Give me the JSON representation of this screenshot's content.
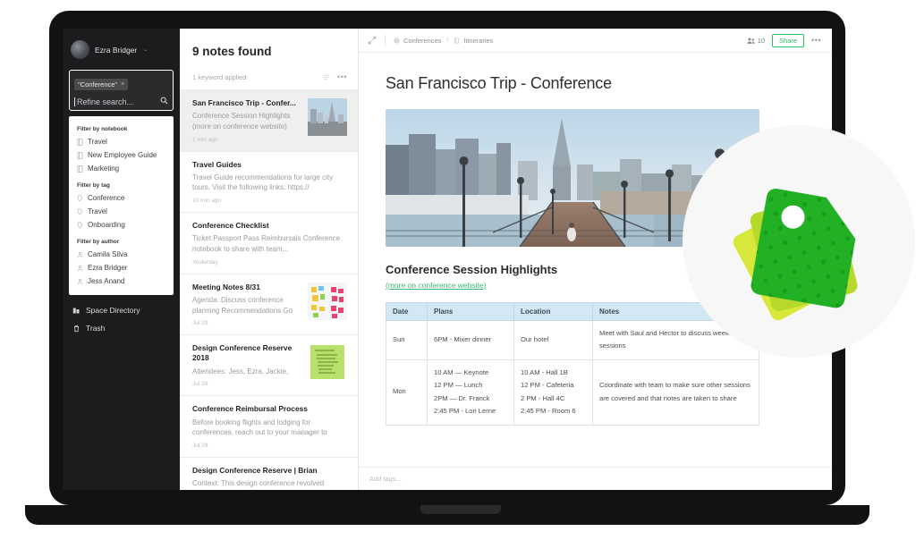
{
  "sidebar": {
    "user": {
      "name": "Ezra Bridger",
      "caret": "⌄",
      "avatar_icon": "user-avatar"
    },
    "search": {
      "chip_label": "\"Conference\"",
      "chip_remove": "×",
      "placeholder": "Refine search...",
      "icon": "search-icon"
    },
    "filters": [
      {
        "title": "Filter by notebook",
        "icon": "notebook-icon",
        "items": [
          "Travel",
          "New Employee Guide",
          "Marketing"
        ]
      },
      {
        "title": "Filter by tag",
        "icon": "tag-icon",
        "items": [
          "Conference",
          "Travel",
          "Onboarding"
        ]
      },
      {
        "title": "Filter by author",
        "icon": "person-icon",
        "items": [
          "Camila Silva",
          "Ezra Bridger",
          "Jess Anand"
        ]
      }
    ],
    "nav": [
      {
        "label": "Space Directory",
        "icon": "directory-icon"
      },
      {
        "label": "Trash",
        "icon": "trash-icon"
      }
    ]
  },
  "notelist": {
    "count_label": "9 notes found",
    "keyword_label": "1 keyword applied",
    "sort_icon": "sort-icon",
    "more_icon": "more-icon",
    "notes": [
      {
        "title": "San Francisco Trip - Confer...",
        "snippet": "Conference Session Highlights (more on conference website)",
        "date": "1 min ago",
        "thumb": "city-photo",
        "selected": true
      },
      {
        "title": "Travel Guides",
        "snippet": "Travel Guide recommendations for large city tours. Visit the following links: https://",
        "date": "10 min ago",
        "thumb": "",
        "selected": false
      },
      {
        "title": "Conference Checklist",
        "snippet": "Ticket Passport Pass Reimbursals Conference notebook to share with team...",
        "date": "Yesterday",
        "thumb": "",
        "selected": false
      },
      {
        "title": "Meeting Notes 8/31",
        "snippet": "Agenda: Discuss conference planning Recommendations Go",
        "date": "Jul 29",
        "thumb": "sticky-notes",
        "selected": false
      },
      {
        "title": "Design Conference Reserve 2018",
        "snippet": "Attendees: Jess, Ezra, Jackie,",
        "date": "Jul 29",
        "thumb": "green-note",
        "selected": false
      },
      {
        "title": "Conference Reimbursal Process",
        "snippet": "Before booking flights and lodging for conferences, reach out to your manager to",
        "date": "Jul 29",
        "thumb": "",
        "selected": false
      },
      {
        "title": "Design Conference Reserve | Brian",
        "snippet": "Context: This design conference revolved",
        "date": "",
        "thumb": "",
        "selected": false
      }
    ]
  },
  "editor": {
    "expand_icon": "expand-icon",
    "breadcrumb": [
      {
        "label": "Conferences",
        "icon": "globe-icon"
      },
      {
        "label": "Itineraries",
        "icon": "notebook-icon"
      }
    ],
    "breadcrumb_separator": "/",
    "collaborators": {
      "icon": "people-icon",
      "count": "10"
    },
    "share_label": "Share",
    "more_label": "•••",
    "doc_title": "San Francisco Trip - Conference",
    "hero_alt": "san-francisco-pier-photo",
    "section_title": "Conference Session Highlights",
    "section_link": "(more on conference website)",
    "table": {
      "headers": [
        "Date",
        "Plans",
        "Location",
        "Notes"
      ],
      "rows": [
        {
          "date": "Sun",
          "plans": [
            "6PM - Mixer dinner"
          ],
          "location": [
            "Our hotel"
          ],
          "notes": "Meet with Saul and Hector to discuss week's sessions"
        },
        {
          "date": "Mon",
          "plans": [
            "10 AM — Keynote",
            "12 PM — Lunch",
            "2PM — Dr. Franck",
            "2:45 PM - Lori Lerne"
          ],
          "location": [
            "10 AM - Hall 1B",
            "12 PM - Cafeteria",
            "2 PM - Hall 4C",
            "2:45 PM - Room 6"
          ],
          "notes": "Coordinate with team to make sure other sessions are covered and that notes are taken to share"
        }
      ]
    },
    "tag_placeholder": "Add tags..."
  },
  "badge": {
    "icon": "tags-badge",
    "green": "#22b024",
    "yellow": "#d7e83a"
  },
  "colors": {
    "accent_green": "#2dbe60",
    "link_green": "#3cb878",
    "sidebar_bg": "#1c1c1e",
    "table_header": "#d4e7f5"
  }
}
